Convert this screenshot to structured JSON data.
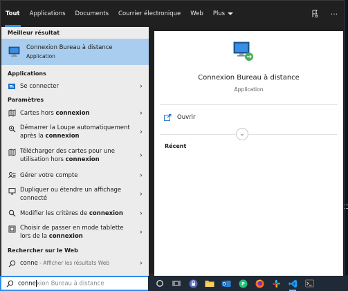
{
  "tabs": [
    {
      "label": "Tout",
      "active": true
    },
    {
      "label": "Applications"
    },
    {
      "label": "Documents"
    },
    {
      "label": "Courrier électronique"
    },
    {
      "label": "Web"
    },
    {
      "label": "Plus"
    }
  ],
  "toolbar_icons": [
    "feedback-icon",
    "more-options-icon"
  ],
  "toolbar": {
    "more_glyph": "···"
  },
  "left": {
    "best_header": "Meilleur résultat",
    "best": {
      "title": "Connexion Bureau à distance",
      "subtitle": "Application"
    },
    "apps_header": "Applications",
    "apps": [
      {
        "pre": "Se connecter",
        "hl": "",
        "post": ""
      }
    ],
    "settings_header": "Paramètres",
    "settings": [
      {
        "line1_pre": "Cartes hors ",
        "line1_hl": "connexion",
        "line2_pre": "",
        "line2_hl": "",
        "icon": "offline-maps-icon"
      },
      {
        "line1_pre": "Démarrer la Loupe automatiquement",
        "line1_hl": "",
        "line2_pre": "après la ",
        "line2_hl": "connexion",
        "icon": "magnifier-icon"
      },
      {
        "line1_pre": "Télécharger des cartes pour une",
        "line1_hl": "",
        "line2_pre": "utilisation hors ",
        "line2_hl": "connexion",
        "icon": "download-maps-icon"
      },
      {
        "line1_pre": "Gérer votre compte",
        "line1_hl": "",
        "line2_pre": "",
        "line2_hl": "",
        "icon": "account-icon"
      },
      {
        "line1_pre": "Dupliquer ou étendre un affichage",
        "line1_hl": "",
        "line2_pre": "connecté",
        "line2_hl": "",
        "icon": "display-icon"
      },
      {
        "line1_pre": "Modifier les critères de ",
        "line1_hl": "connexion",
        "line2_pre": "",
        "line2_hl": "",
        "icon": "search-settings-icon"
      },
      {
        "line1_pre": "Choisir de passer en mode tablette",
        "line1_hl": "",
        "line2_pre": "lors de la ",
        "line2_hl": "connexion",
        "icon": "tablet-mode-icon"
      }
    ],
    "web_header": "Rechercher sur le Web",
    "web": {
      "query": "conne",
      "suffix": " - Afficher les résultats Web"
    }
  },
  "preview": {
    "title": "Connexion Bureau à distance",
    "subtitle": "Application",
    "open_label": "Ouvrir",
    "recent_label": "Récent"
  },
  "search": {
    "typed": "conne",
    "ghost": "xion Bureau à distance"
  },
  "taskbar": {
    "icons": [
      "cortana-icon",
      "task-view-icon",
      "security-icon",
      "file-explorer-icon",
      "outlook-icon",
      "pycharm-icon",
      "firefox-icon",
      "slack-icon",
      "vscode-icon",
      "windows-terminal-icon"
    ]
  },
  "colors": {
    "accent": "#3b8be0",
    "best_bg": "#a9cdee",
    "left_bg": "#ececec",
    "tabbar_bg": "#202020",
    "taskbar_bg": "#202a36"
  }
}
